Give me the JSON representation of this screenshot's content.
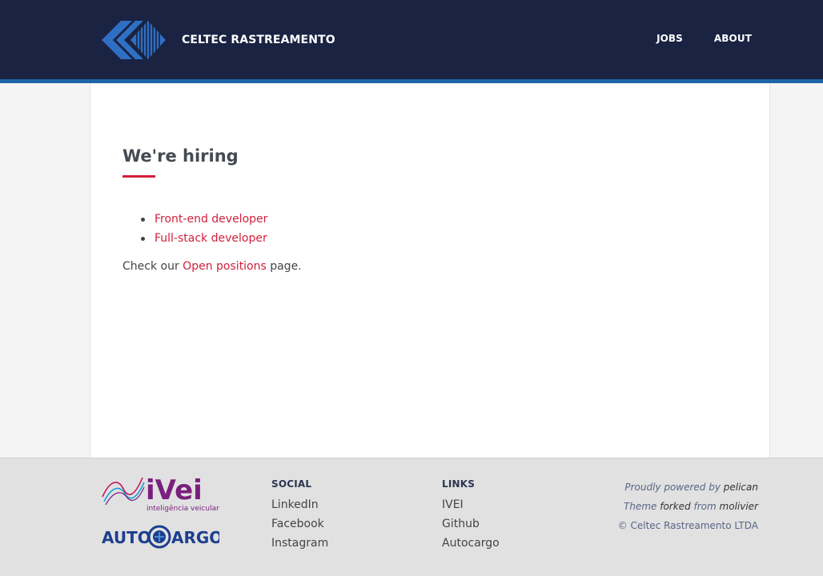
{
  "header": {
    "brand_name": "CELTEC RASTREAMENTO",
    "nav": [
      {
        "label": "JOBS"
      },
      {
        "label": "ABOUT"
      }
    ]
  },
  "main": {
    "title": "We're hiring",
    "jobs": [
      {
        "label": "Front-end developer"
      },
      {
        "label": "Full-stack developer"
      }
    ],
    "check_prefix": "Check our",
    "check_link": "Open positions",
    "check_suffix": "page."
  },
  "footer": {
    "ivei_tagline": "inteligência veicular",
    "autocargo_left": "AUTO",
    "autocargo_right": "ARGO",
    "social": {
      "heading": "SOCIAL",
      "items": [
        {
          "label": "LinkedIn"
        },
        {
          "label": "Facebook"
        },
        {
          "label": "Instagram"
        }
      ]
    },
    "links": {
      "heading": "LINKS",
      "items": [
        {
          "label": "IVEI"
        },
        {
          "label": "Github"
        },
        {
          "label": "Autocargo"
        }
      ]
    },
    "credits": {
      "powered_prefix": "Proudly powered by",
      "powered_name": "pelican",
      "theme_word": "Theme",
      "forked_word": "forked",
      "from_word": "from",
      "theme_name": "molivier",
      "copyright": "© Celtec Rastreamento LTDA"
    }
  },
  "colors": {
    "header_bg": "#1a2341",
    "header_stripe": "#1e64a8",
    "accent_red": "#d21f3c",
    "footer_bg": "#e1e1e1",
    "ivei_purple": "#7a1f7d",
    "autocargo_blue": "#1d3f8f"
  },
  "icons": {
    "brand": "celtec-logo",
    "ivei": "ivei-logo",
    "autocargo": "autocargo-logo"
  }
}
